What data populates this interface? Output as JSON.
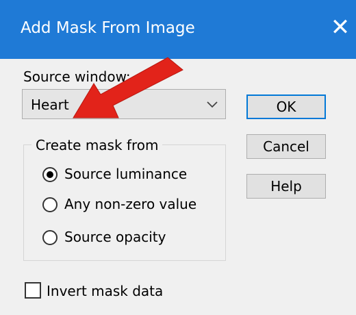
{
  "dialog": {
    "title": "Add Mask From Image"
  },
  "source_window": {
    "label": "Source window:",
    "selected": "Heart"
  },
  "create_mask_from": {
    "legend": "Create mask from",
    "options": [
      {
        "label": "Source luminance",
        "checked": true
      },
      {
        "label": "Any non-zero value",
        "checked": false
      },
      {
        "label": "Source opacity",
        "checked": false
      }
    ]
  },
  "invert": {
    "label": "Invert mask data",
    "checked": false
  },
  "buttons": {
    "ok": "OK",
    "cancel": "Cancel",
    "help": "Help"
  },
  "colors": {
    "titlebar": "#1f7ad6",
    "annotation_arrow": "#e2231a",
    "default_button_border": "#0078d7"
  }
}
